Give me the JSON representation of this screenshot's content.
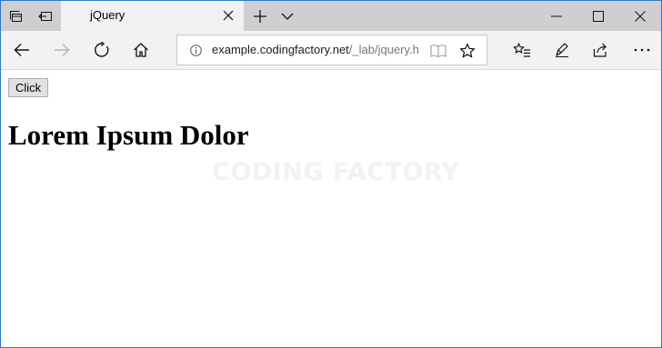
{
  "tab": {
    "title": "jQuery"
  },
  "address_bar": {
    "host": "example.codingfactory.net",
    "path": "/_lab/jquery.ht"
  },
  "page": {
    "button_label": "Click",
    "heading": "Lorem Ipsum Dolor",
    "watermark": "CODING FACTORY"
  },
  "icons": {
    "tab_actions": [
      "tabs-aside-icon",
      "set-tabs-aside-icon"
    ],
    "new_tab": "plus-icon",
    "tab_list": "chevron-down-icon",
    "window": [
      "minimize-icon",
      "maximize-icon",
      "close-icon"
    ],
    "nav": [
      "back-arrow-icon",
      "forward-arrow-icon",
      "refresh-icon",
      "home-icon"
    ],
    "address": [
      "info-icon",
      "reading-view-icon",
      "favorite-star-icon"
    ],
    "toolbar": [
      "favorites-hub-icon",
      "pen-icon",
      "share-icon",
      "more-icon"
    ]
  },
  "colors": {
    "window_border": "#2b79d6",
    "tabbar_bg": "#cfcfcf",
    "active_tab_bg": "#f2f2f2",
    "watermark": "#f2f2f2"
  }
}
